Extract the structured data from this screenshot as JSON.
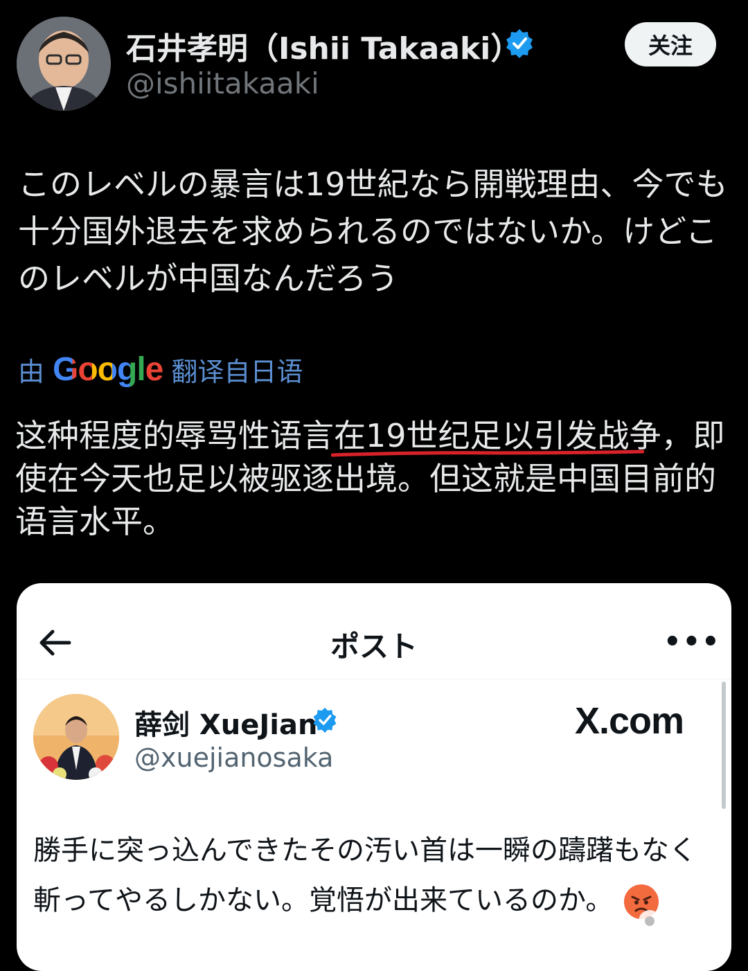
{
  "profile": {
    "display_name": "石井孝明（Ishii Takaaki）",
    "handle": "@ishiitakaaki",
    "follow_label": "关注"
  },
  "post": {
    "original_text": "このレベルの暴言は19世紀なら開戦理由、今でも十分国外退去を求められるのではないか。けどこのレベルが中国なんだろう",
    "translation_prefix": "由",
    "translation_brand": "Google",
    "translation_suffix": "翻译自日语",
    "translated_before": "这种程度的辱骂性语言",
    "translated_highlight": "在19世纪足以引发战争",
    "translated_after": "，即使在今天也足以被驱逐出境。但这就是中国目前的语言水平。"
  },
  "embedded": {
    "title": "ポスト",
    "more_label": "•••",
    "display_name": "薛剑 XueJian",
    "handle": "@xuejianosaka",
    "brand": "X.com",
    "text": "勝手に突っ込んできたその汚い首は一瞬の躊躇もなく斬ってやるしかない。覚悟が出来ているのか。"
  },
  "colors": {
    "background": "#000000",
    "text": "#e7e9ea",
    "muted": "#71767b",
    "verified": "#1d9bf0",
    "translate_link": "#5b8fd1",
    "underline": "#d8222a",
    "card_bg": "#ffffff"
  },
  "icons": [
    "verified-badge-icon",
    "back-arrow-icon",
    "more-icon",
    "angry-face-emoji"
  ]
}
